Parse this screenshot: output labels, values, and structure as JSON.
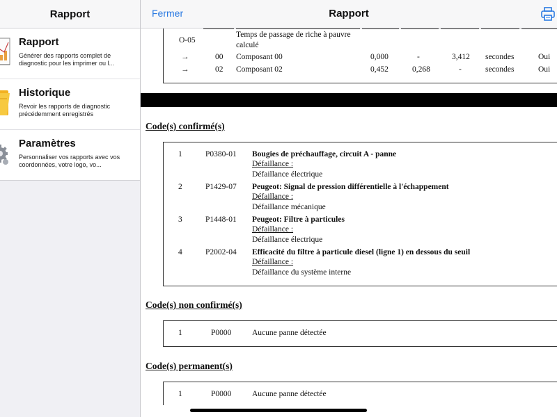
{
  "sidebar": {
    "title": "Rapport",
    "items": [
      {
        "title": "Rapport",
        "desc": "Générer des rapports complet de diagnostic pour les imprimer ou l...",
        "icon": "report-chart-icon"
      },
      {
        "title": "Historique",
        "desc": "Revoir les rapports de diagnostic précédemment enregistrés",
        "icon": "history-folder-icon"
      },
      {
        "title": "Paramètres",
        "desc": "Personnaliser vos rapports avec vos coordonnées, votre logo, vo...",
        "icon": "settings-gear-icon"
      }
    ]
  },
  "header": {
    "close_label": "Fermer",
    "title": "Rapport",
    "print_icon": "printer-icon",
    "accent_color": "#2a7ae2"
  },
  "sensor_table": {
    "id": "O-05",
    "title_line1": "Temps de passage de riche à pauvre",
    "title_line2": "calculé",
    "rows": [
      {
        "arrow": "→",
        "num": "00",
        "name": "Composant 00",
        "v1": "0,000",
        "v2": "-",
        "v3": "3,412",
        "unit": "secondes",
        "ok": "Oui"
      },
      {
        "arrow": "→",
        "num": "02",
        "name": "Composant 02",
        "v1": "0,452",
        "v2": "0,268",
        "v3": "-",
        "unit": "secondes",
        "ok": "Oui"
      }
    ]
  },
  "confirmed": {
    "title": "Code(s) confirmé(s)",
    "codes": [
      {
        "idx": "1",
        "code": "P0380-01",
        "title": "Bougies de préchauffage, circuit A - panne",
        "sub": "Défaillance :",
        "detail": "Défaillance électrique"
      },
      {
        "idx": "2",
        "code": "P1429-07",
        "title": "Peugeot: Signal de pression différentielle à l'échappement",
        "sub": "Défaillance :",
        "detail": "Défaillance mécanique"
      },
      {
        "idx": "3",
        "code": "P1448-01",
        "title": "Peugeot: Filtre à particules",
        "sub": "Défaillance :",
        "detail": "Défaillance électrique"
      },
      {
        "idx": "4",
        "code": "P2002-04",
        "title": "Efficacité du filtre à particule diesel (ligne 1) en dessous du seuil",
        "sub": "Défaillance :",
        "detail": "Défaillance du système interne"
      }
    ]
  },
  "unconfirmed": {
    "title": "Code(s) non confirmé(s)",
    "row": {
      "idx": "1",
      "code": "P0000",
      "text": "Aucune panne détectée"
    }
  },
  "permanent": {
    "title": "Code(s) permanent(s)",
    "row": {
      "idx": "1",
      "code": "P0000",
      "text": "Aucune panne détectée"
    }
  }
}
